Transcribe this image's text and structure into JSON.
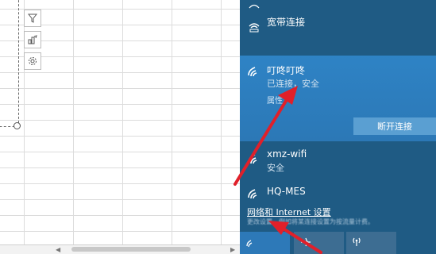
{
  "flyout": {
    "networks": [
      {
        "name": "宽带连接",
        "status": ""
      },
      {
        "name": "叮咚叮咚",
        "status": "已连接，安全",
        "properties_label": "属性"
      },
      {
        "name": "xmz-wifi",
        "status": "安全"
      },
      {
        "name": "HQ-MES",
        "status": ""
      }
    ],
    "disconnect_label": "断开连接",
    "settings_link": "网络和 Internet 设置",
    "settings_desc": "更改设置，例如将某连接设置为按流量计费。"
  },
  "colors": {
    "flyout_bg": "#1f5b84",
    "active_bg": "#2e83c5",
    "arrow": "#e0202a"
  },
  "icons": {
    "chart_tools": [
      "filter-icon",
      "chart-style-icon",
      "chart-settings-icon"
    ],
    "network": "wifi-icon",
    "quick_actions": [
      "wifi-icon",
      "airplane-icon",
      "hotspot-icon"
    ]
  }
}
